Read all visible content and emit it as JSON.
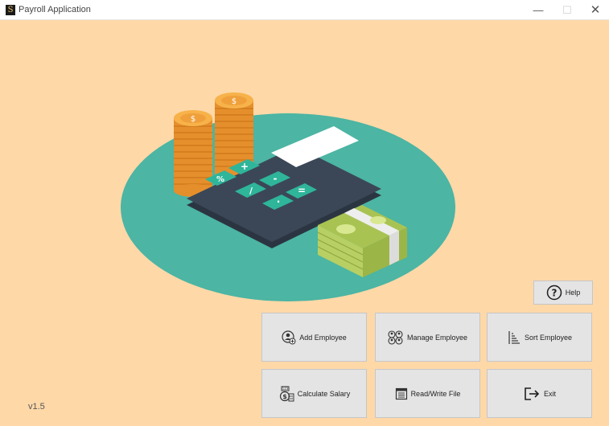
{
  "window": {
    "title": "Payroll Application",
    "icon_letter": "S",
    "minimize": "—",
    "maximize": "☐",
    "close": "✕"
  },
  "buttons": {
    "help": "Help",
    "add_employee": "Add Employee",
    "manage_employee": "Manage Employee",
    "sort_employee": "Sort Employee",
    "calculate_salary": "Calculate Salary",
    "read_write_file": "Read/Write File",
    "exit": "Exit"
  },
  "version": "v1.5",
  "colors": {
    "background": "#ffd8a8",
    "oval": "#4cb5a3",
    "calculator": "#364150",
    "coin": "#f0a03a",
    "money": "#c9df79"
  },
  "icons": {
    "help": "question-circle-icon",
    "add_employee": "add-user-icon",
    "manage_employee": "manage-users-icon",
    "sort_employee": "sort-icon",
    "calculate_salary": "money-calculate-icon",
    "read_write_file": "file-icon",
    "exit": "exit-icon"
  }
}
